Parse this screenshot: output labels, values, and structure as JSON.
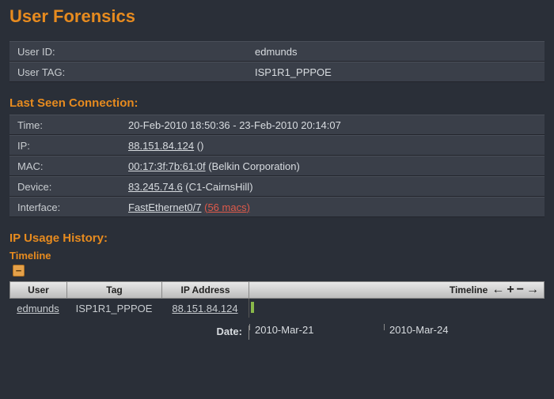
{
  "page_title": "User Forensics",
  "user_info": {
    "id_label": "User ID:",
    "id_value": "edmunds",
    "tag_label": "User TAG:",
    "tag_value": "ISP1R1_PPPOE"
  },
  "last_seen": {
    "heading": "Last Seen Connection:",
    "rows": {
      "time_label": "Time:",
      "time_value": "20-Feb-2010 18:50:36 - 23-Feb-2010 20:14:07",
      "ip_label": "IP:",
      "ip_link": "88.151.84.124",
      "ip_suffix": " ()",
      "mac_label": "MAC:",
      "mac_link": "00:17:3f:7b:61:0f",
      "mac_suffix": " (Belkin Corporation)",
      "dev_label": "Device:",
      "dev_link": "83.245.74.6",
      "dev_suffix": " (C1-CairnsHill)",
      "if_label": "Interface:",
      "if_link": "FastEthernet0/7",
      "if_macs": "(56 macs)"
    }
  },
  "history": {
    "heading": "IP Usage History:",
    "timeline_label": "Timeline",
    "collapse_glyph": "−",
    "cols": {
      "user": "User",
      "tag": "Tag",
      "ip": "IP Address",
      "timeline": "Timeline"
    },
    "tools": {
      "left": "←",
      "plus": "+",
      "minus": "−",
      "right": "→"
    },
    "row": {
      "user": "edmunds",
      "tag": "ISP1R1_PPPOE",
      "ip": "88.151.84.124"
    },
    "date_axis": {
      "label": "Date:",
      "tick1": "2010-Mar-21",
      "tick2": "2010-Mar-24"
    }
  }
}
